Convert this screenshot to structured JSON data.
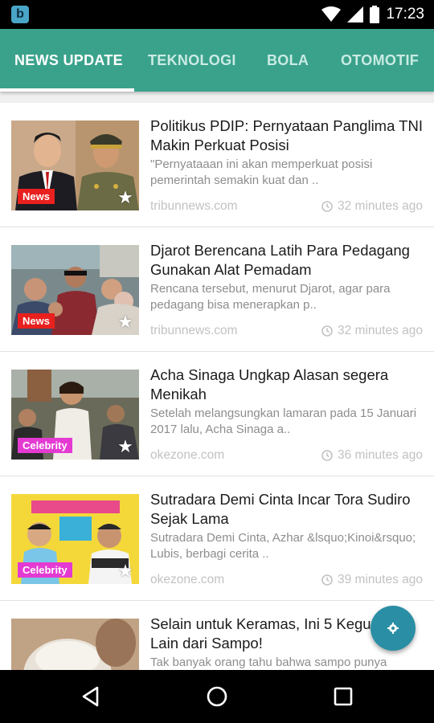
{
  "status_bar": {
    "app_badge": "b",
    "time": "17:23",
    "icons": [
      "wifi-icon",
      "signal-icon",
      "battery-icon"
    ]
  },
  "tabs": [
    {
      "label": "NEWS UPDATE",
      "active": true
    },
    {
      "label": "TEKNOLOGI",
      "active": false
    },
    {
      "label": "BOLA",
      "active": false
    },
    {
      "label": "OTOMOTIF",
      "active": false
    }
  ],
  "colors": {
    "app_bar": "#3aa28b",
    "badge_news": "#e8201e",
    "badge_celebrity": "#e43ad2",
    "fab": "#2a8fa5"
  },
  "articles": [
    {
      "title": "Politikus PDIP: Pernyataan Panglima TNI Makin Perkuat Posisi",
      "description": "\"Pernyataaan ini akan memperkuat posisi pemerintah semakin kuat dan ..",
      "category": "News",
      "source": "tribunnews.com",
      "time": "32 minutes ago"
    },
    {
      "title": "Djarot Berencana Latih Para Pedagang Gunakan Alat Pemadam",
      "description": "Rencana tersebut, menurut Djarot, agar para pedagang bisa menerapkan p..",
      "category": "News",
      "source": "tribunnews.com",
      "time": "32 minutes ago"
    },
    {
      "title": "Acha Sinaga Ungkap Alasan segera Menikah",
      "description": "Setelah melangsungkan lamaran pada 15 Januari 2017 lalu, Acha Sinaga a..",
      "category": "Celebrity",
      "source": "okezone.com",
      "time": "36 minutes ago"
    },
    {
      "title": "Sutradara Demi Cinta Incar Tora Sudiro Sejak Lama",
      "description": "Sutradara Demi Cinta, Azhar &lsquo;Kinoi&rsquo; Lubis, berbagi cerita ..",
      "category": "Celebrity",
      "source": "okezone.com",
      "time": "39 minutes ago"
    },
    {
      "title": "Selain untuk Keramas, Ini 5 Kegunaan Lain dari Sampo!",
      "description": "Tak banyak orang tahu bahwa sampo punya",
      "category": "",
      "source": "",
      "time": ""
    }
  ],
  "fab": {
    "icon": "settings-icon"
  },
  "nav_bar": {
    "icons": [
      "back-icon",
      "home-icon",
      "recents-icon"
    ]
  }
}
